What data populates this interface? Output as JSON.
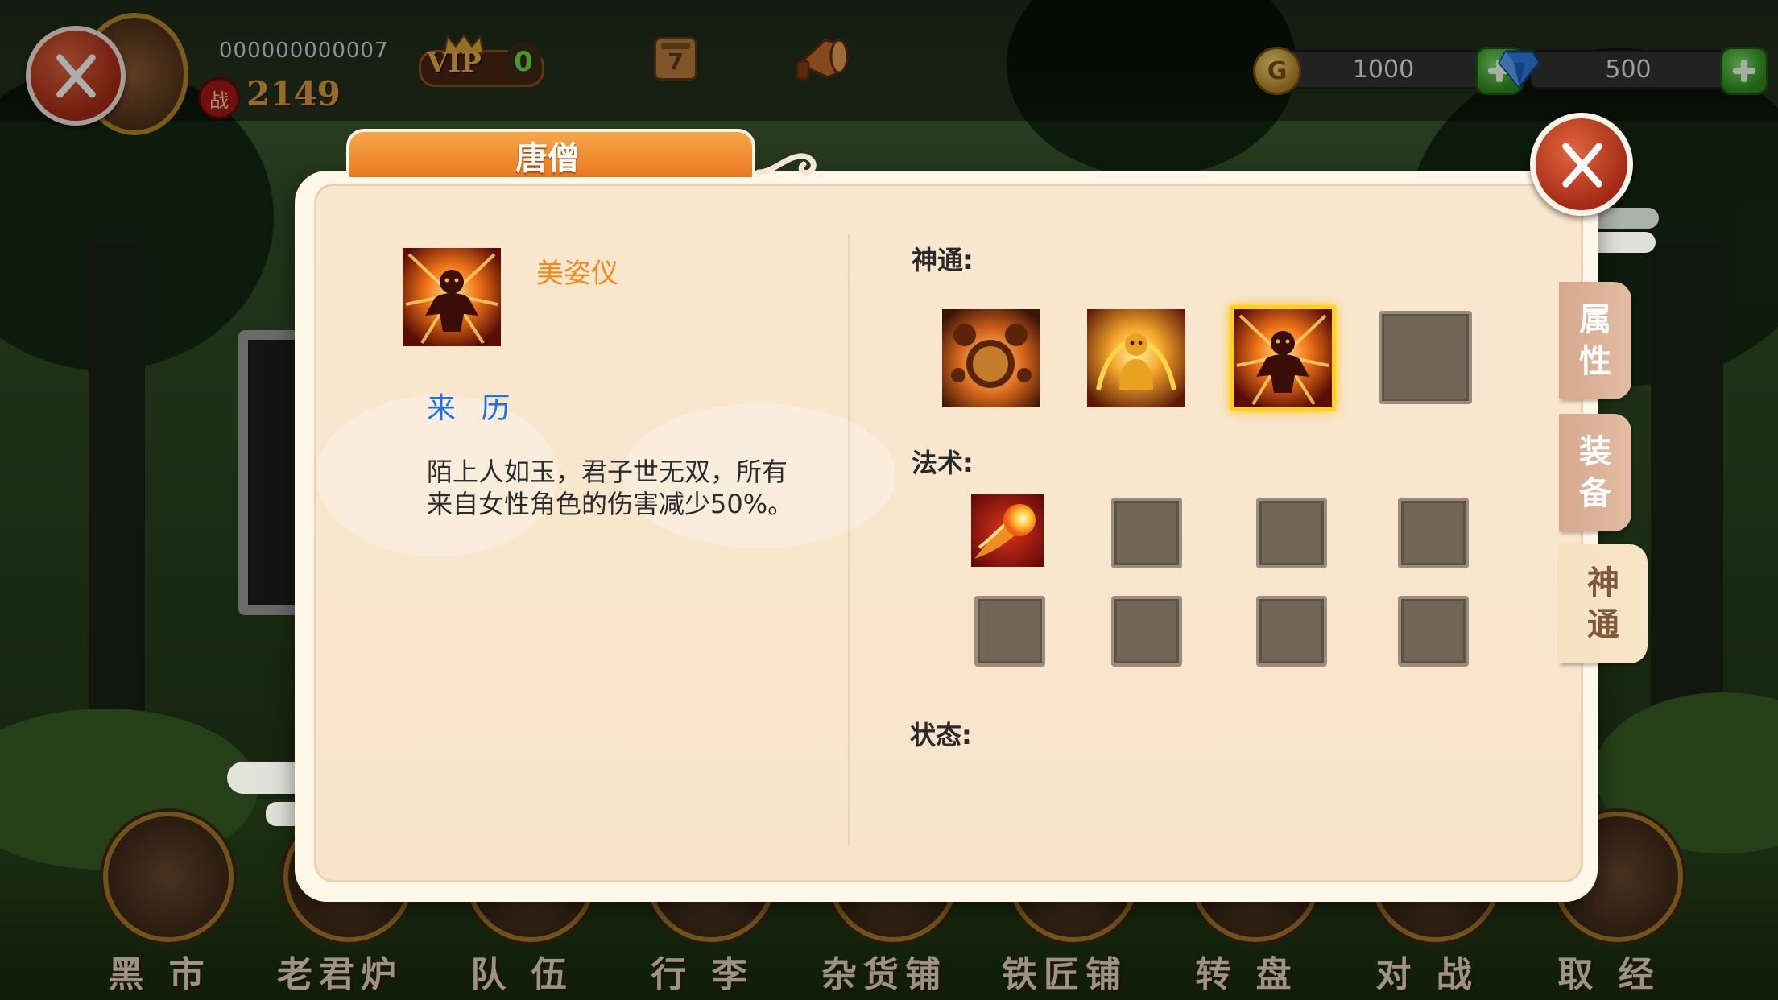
{
  "player": {
    "id": "000000000007",
    "battle_badge": "战",
    "power": "2149",
    "vip_label": "VIP",
    "vip_level": "0"
  },
  "calendar_day": "7",
  "currency": {
    "gold": "1000",
    "gems": "500"
  },
  "panel": {
    "title": "唐僧",
    "skill_name": "美姿仪",
    "origin_label": "来 历",
    "description": "陌上人如玉，君子世无双，所有来自女性角色的伤害减少50%。",
    "section_shentong": "神通:",
    "section_fashu": "法术:",
    "section_status": "状态:"
  },
  "side_tabs": [
    {
      "label_1": "属",
      "label_2": "性"
    },
    {
      "label_1": "装",
      "label_2": "备"
    },
    {
      "label_1": "神",
      "label_2": "通"
    }
  ],
  "bottom_nav": [
    {
      "label": "黑 市"
    },
    {
      "label": "老君炉"
    },
    {
      "label": "队 伍"
    },
    {
      "label": "行 李"
    },
    {
      "label": "杂货铺"
    },
    {
      "label": "铁匠铺"
    },
    {
      "label": "转 盘"
    },
    {
      "label": "对 战"
    },
    {
      "label": "取 经"
    }
  ],
  "colors": {
    "title_orange": "#e8791d",
    "skill_name": "#f08a1a",
    "origin_blue": "#1e72e6",
    "selected_glow": "#ffd21a",
    "close_red": "#a52a16"
  }
}
